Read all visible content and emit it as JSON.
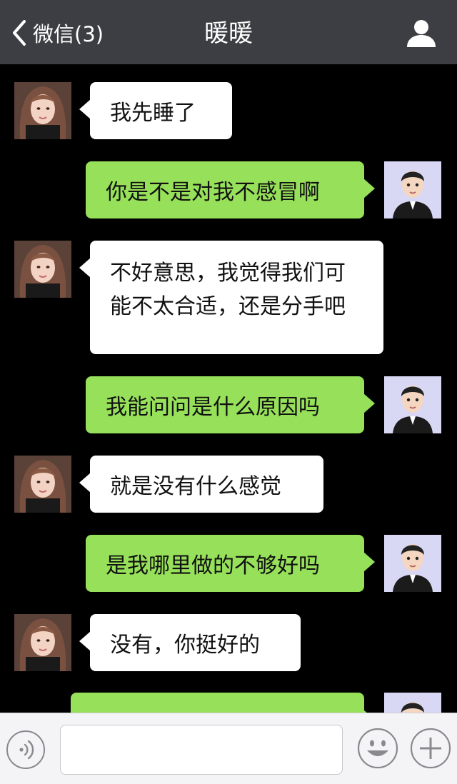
{
  "header": {
    "back_label": "微信(3)",
    "title": "暖暖"
  },
  "messages": [
    {
      "side": "left",
      "text": "我先睡了"
    },
    {
      "side": "right",
      "text": "你是不是对我不感冒啊"
    },
    {
      "side": "left",
      "text": "不好意思，我觉得我们可能不太合适，还是分手吧"
    },
    {
      "side": "right",
      "text": "我能问问是什么原因吗"
    },
    {
      "side": "left",
      "text": "就是没有什么感觉"
    },
    {
      "side": "right",
      "text": "是我哪里做的不够好吗"
    },
    {
      "side": "left",
      "text": "没有，你挺好的"
    },
    {
      "side": "right",
      "text": ""
    }
  ],
  "input": {
    "value": "",
    "placeholder": ""
  },
  "colors": {
    "header_bg": "#3d3e43",
    "chat_bg": "#000000",
    "bubble_received": "#ffffff",
    "bubble_sent": "#97e15a",
    "input_bar_bg": "#f4f4f6"
  },
  "icons": {
    "back": "chevron-left-icon",
    "profile": "person-icon",
    "voice": "voice-icon",
    "emoji": "smiley-icon",
    "plus": "plus-icon"
  }
}
